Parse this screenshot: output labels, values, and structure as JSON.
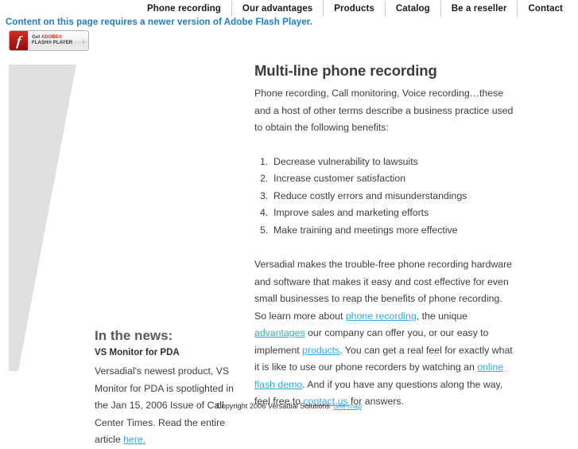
{
  "nav": {
    "items": [
      {
        "label": "Phone recording"
      },
      {
        "label": "Our advantages"
      },
      {
        "label": "Products"
      },
      {
        "label": "Catalog"
      },
      {
        "label": "Be a reseller"
      },
      {
        "label": "Contact"
      }
    ]
  },
  "flash": {
    "warning": "Content on this page requires a newer version of Adobe Flash Player.",
    "warning_color": "#1b7fc4",
    "badge": {
      "get": "Get ",
      "adobe": "ADOBE®",
      "line2": "FLASH® PLAYER",
      "arrow": "↓",
      "logo_glyph": "f"
    }
  },
  "main": {
    "title": "Multi-line phone recording",
    "intro": "Phone recording, Call monitoring, Voice recording…these and a host of other terms describe a business practice used to obtain the following benefits:",
    "benefits": [
      "Decrease vulnerability to lawsuits",
      "Increase customer satisfaction",
      "Reduce costly errors and misunderstandings",
      "Improve sales and marketing efforts",
      "Make training and meetings more effective"
    ],
    "paragraph2": {
      "t1": "Versadial makes the trouble-free phone recording hardware and software that makes it easy and cost effective for even small businesses to reap the benefits of phone recording. So learn more about ",
      "link1": "phone recording",
      "t2": ", the unique ",
      "link2": "advantages",
      "t3": " our company can offer you, or our easy to implement ",
      "link3": "products",
      "t4": ". You can get a real feel for exactly what it is like to use our phone recorders by watching an ",
      "link4": "online flash demo",
      "t5": ". And if you have any questions along the way, feel free to ",
      "link5": "contact us",
      "t6": " for answers."
    },
    "link_color": "#34a9df"
  },
  "news": {
    "heading": "In the news:",
    "subheading": "VS Monitor for PDA",
    "body_before": "Versadial's newest product, VS Monitor for PDA is spotlighted in the Jan 15, 2006 Issue of Call Center Times. Read the entire article ",
    "link": "here."
  },
  "footer": {
    "copyright": "Copyright 2006 Versadial Solutions",
    "sitemap": "Site map"
  },
  "decor": {
    "wedge_color": "#e0e0e0"
  }
}
